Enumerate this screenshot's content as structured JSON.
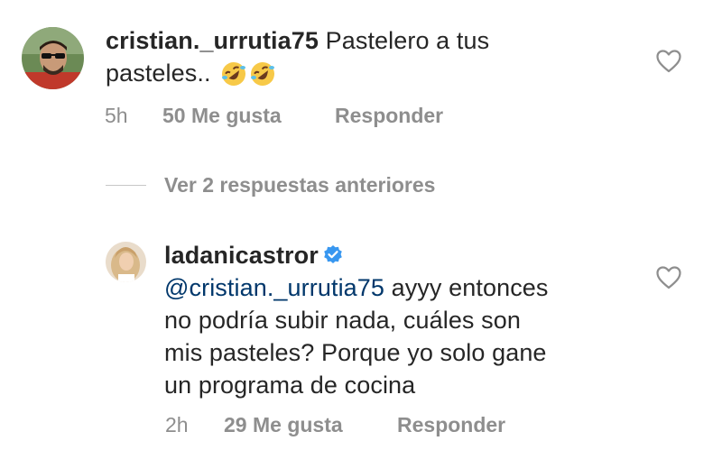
{
  "comment1": {
    "username": "cristian._urrutia75",
    "text_line1": " Pastelero a tus",
    "text_line2": "pasteles..",
    "emojis": [
      "rolling-on-floor-laughing",
      "rolling-on-floor-laughing"
    ],
    "time": "5h",
    "likes": "50 Me gusta",
    "reply_label": "Responder"
  },
  "view_replies": "Ver 2 respuestas anteriores",
  "reply1": {
    "username": "ladanicastror",
    "verified": true,
    "mention": "@cristian._urrutia75",
    "text_line1": " ayyy entonces",
    "text_line2": "no podría subir nada, cuáles son",
    "text_line3": "mis pasteles? Porque yo solo gane",
    "text_line4": "un programa de cocina",
    "time": "2h",
    "likes": "29 Me gusta",
    "reply_label": "Responder"
  },
  "colors": {
    "text": "#262626",
    "secondary": "#8e8e8e",
    "mention": "#00376b",
    "verified": "#3897f0"
  }
}
